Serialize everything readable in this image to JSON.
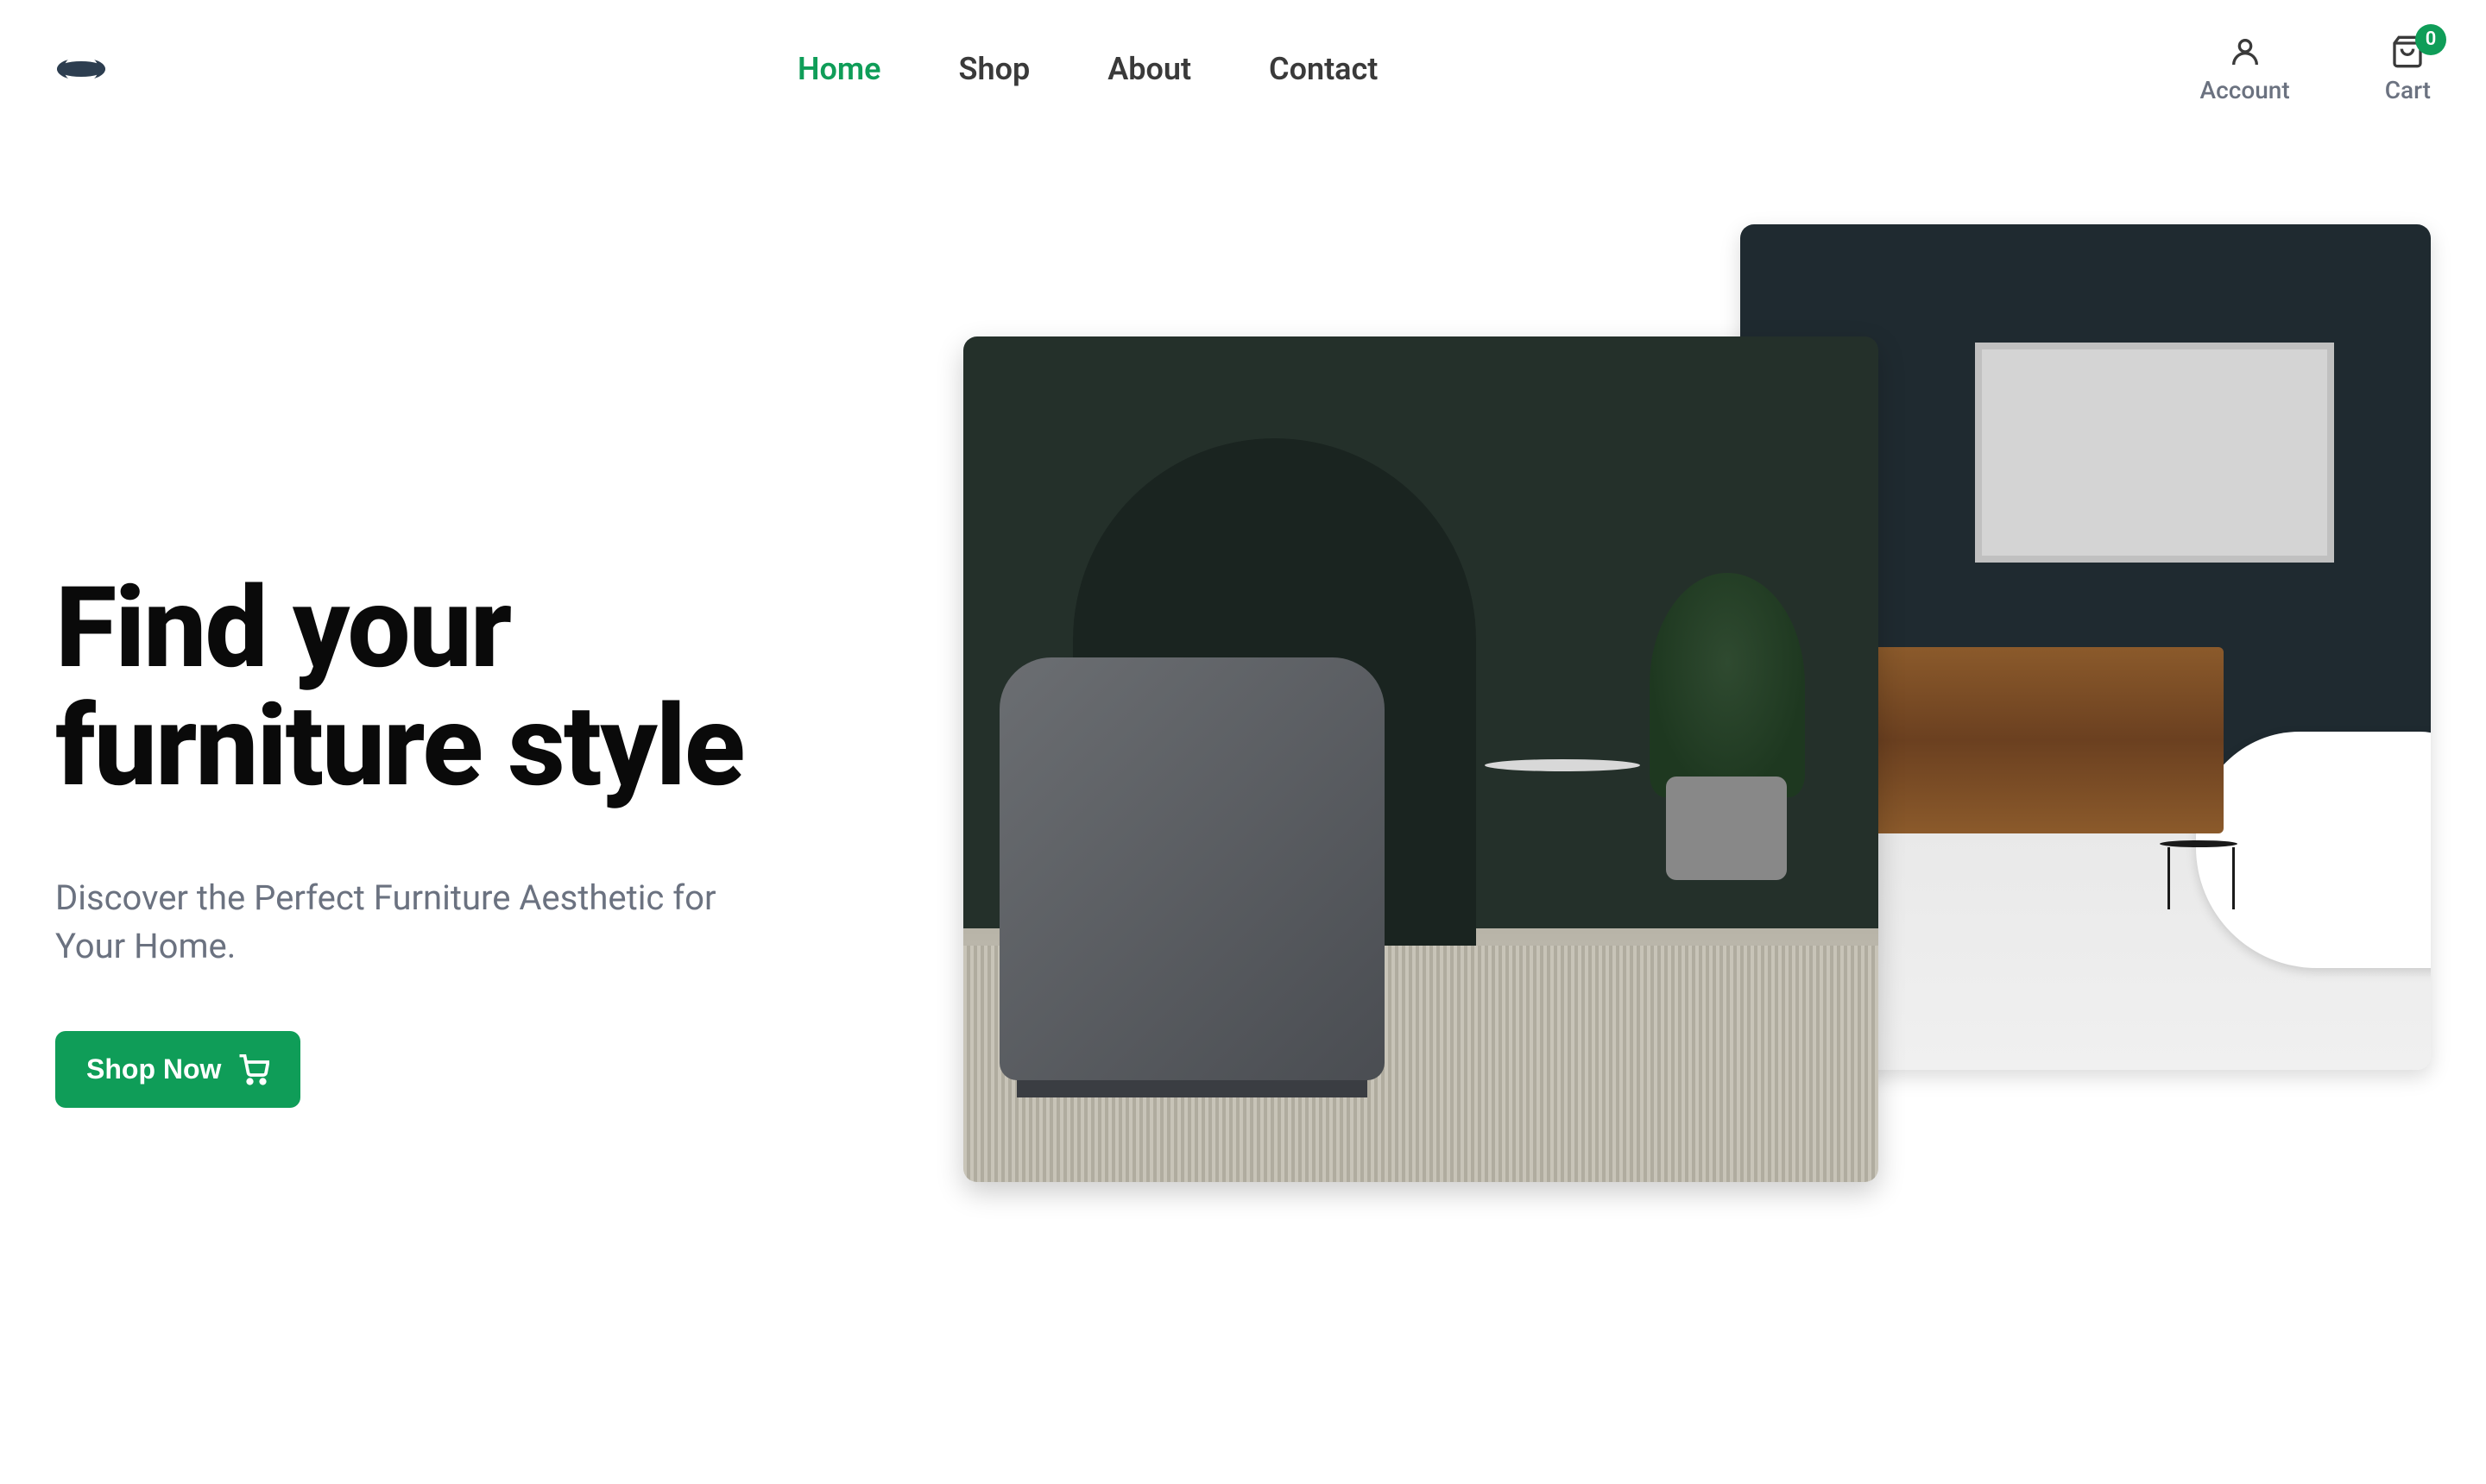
{
  "nav": {
    "items": [
      {
        "label": "Home",
        "active": true
      },
      {
        "label": "Shop",
        "active": false
      },
      {
        "label": "About",
        "active": false
      },
      {
        "label": "Contact",
        "active": false
      }
    ]
  },
  "header": {
    "account_label": "Account",
    "cart_label": "Cart",
    "cart_count": "0"
  },
  "hero": {
    "title_line1": "Find your",
    "title_line2": "furniture style",
    "subtitle": "Discover the Perfect Furniture Aesthetic for Your Home.",
    "cta_label": "Shop Now"
  },
  "colors": {
    "accent": "#0f9d58"
  }
}
